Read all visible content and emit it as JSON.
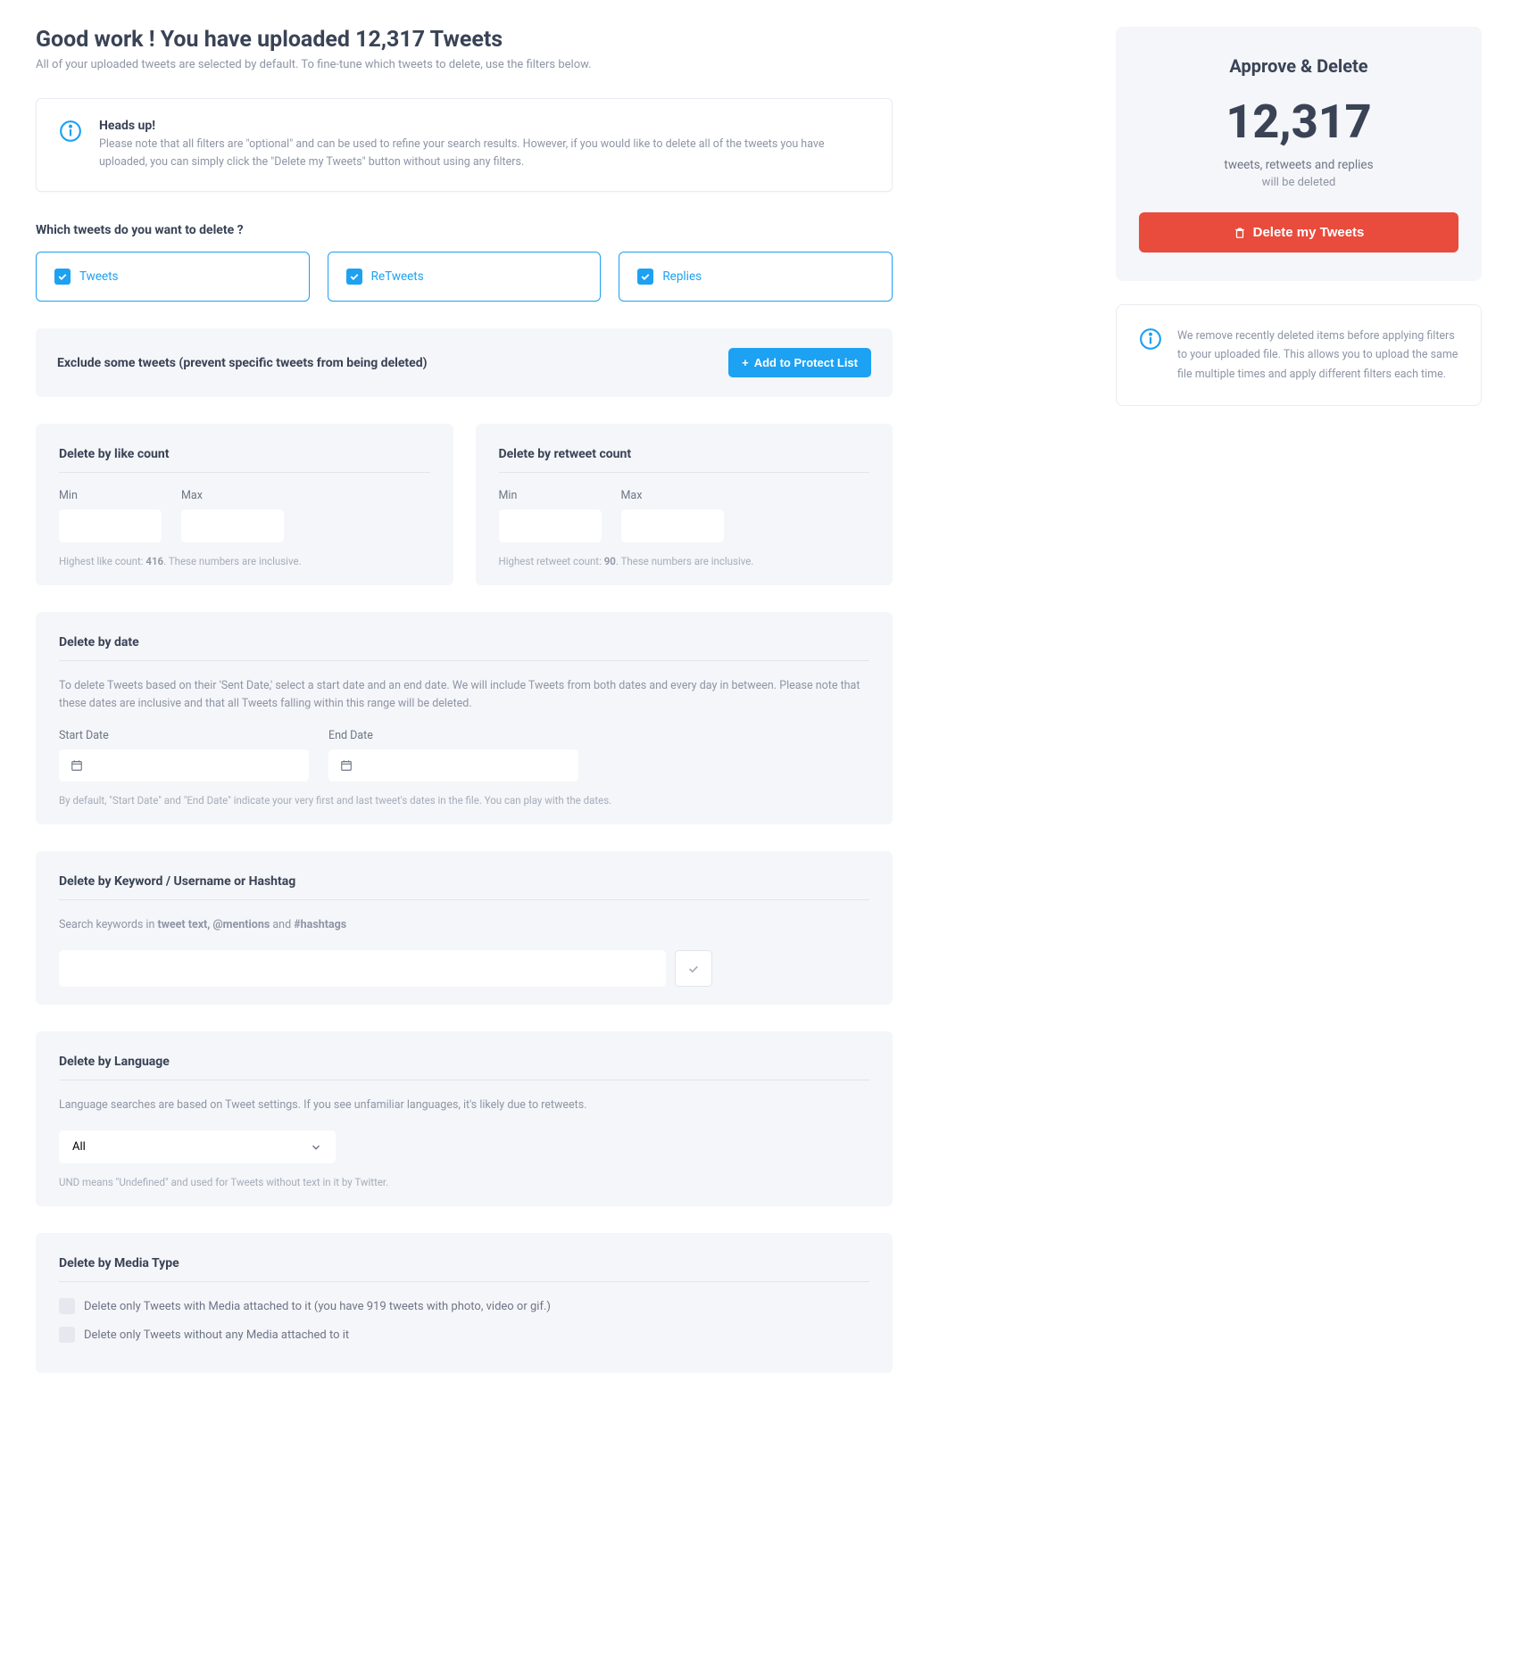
{
  "header": {
    "title": "Good work ! You have uploaded 12,317 Tweets",
    "subtitle": "All of your uploaded tweets are selected by default. To fine-tune which tweets to delete, use the filters below."
  },
  "alert": {
    "title": "Heads up!",
    "text": "Please note that all filters are \"optional\" and can be used to refine your search results. However, if you would like to delete all of the tweets you have uploaded, you can simply click the \"Delete my Tweets\" button without using any filters."
  },
  "which": {
    "title": "Which tweets do you want to delete ?",
    "types": [
      "Tweets",
      "ReTweets",
      "Replies"
    ]
  },
  "exclude": {
    "title": "Exclude some tweets (prevent specific tweets from being deleted)",
    "button": "Add to Protect List"
  },
  "likeCount": {
    "title": "Delete by like count",
    "min": "Min",
    "max": "Max",
    "hint_pre": "Highest like count: ",
    "hint_val": "416",
    "hint_post": ". These numbers are inclusive."
  },
  "retweetCount": {
    "title": "Delete by retweet count",
    "min": "Min",
    "max": "Max",
    "hint_pre": "Highest retweet count: ",
    "hint_val": "90",
    "hint_post": ". These numbers are inclusive."
  },
  "date": {
    "title": "Delete by date",
    "desc": "To delete Tweets based on their 'Sent Date,' select a start date and an end date. We will include Tweets from both dates and every day in between. Please note that these dates are inclusive and that all Tweets falling within this range will be deleted.",
    "start": "Start Date",
    "end": "End Date",
    "hint": "By default, \"Start Date\" and \"End Date\" indicate your very first and last tweet's dates in the file. You can play with the dates."
  },
  "keyword": {
    "title": "Delete by Keyword / Username or Hashtag",
    "desc_pre": "Search keywords in ",
    "desc_b1": "tweet text, @mentions",
    "desc_mid": " and ",
    "desc_b2": "#hashtags"
  },
  "language": {
    "title": "Delete by Language",
    "desc": "Language searches are based on Tweet settings. If you see unfamiliar languages, it's likely due to retweets.",
    "selected": "All",
    "hint": "UND means \"Undefined\" and used for Tweets without text in it by Twitter."
  },
  "media": {
    "title": "Delete by Media Type",
    "opt1": "Delete only Tweets with Media attached to it (you have 919 tweets with photo, video or gif.)",
    "opt2": "Delete only Tweets without any Media attached to it"
  },
  "approve": {
    "title": "Approve & Delete",
    "count": "12,317",
    "sub1": "tweets, retweets and replies",
    "sub2": "will be deleted",
    "button": "Delete my Tweets"
  },
  "info": {
    "text": "We remove recently deleted items before applying filters to your uploaded file. This allows you to upload the same file multiple times and apply different filters each time."
  }
}
